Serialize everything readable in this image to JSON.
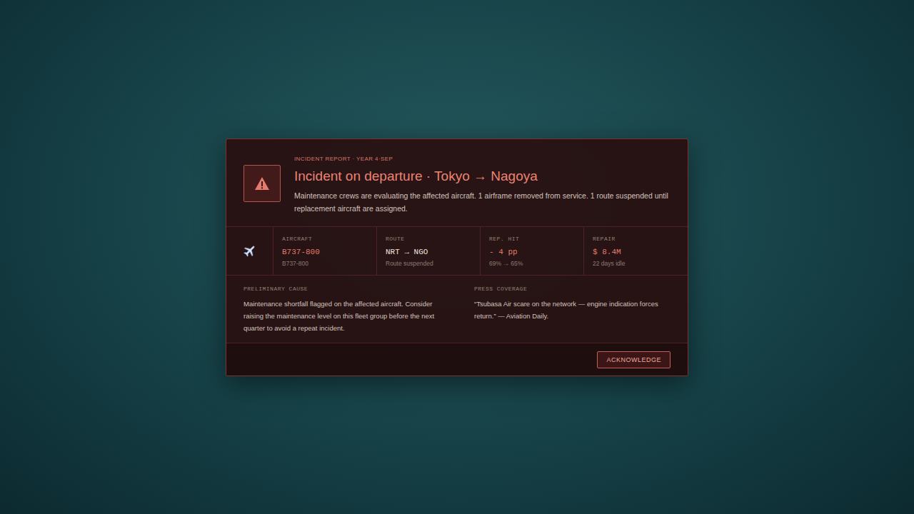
{
  "incident": {
    "overline": "INCIDENT REPORT · YEAR 4·SEP",
    "title": "Incident on departure · Tokyo → Nagoya",
    "description": "Maintenance crews are evaluating the affected aircraft. 1 airframe removed from service. 1 route suspended until replacement aircraft are assigned."
  },
  "stats": [
    {
      "label": "AIRCRAFT",
      "value": "B737-800",
      "detail": "B737-800",
      "color": "#e07b6e"
    },
    {
      "label": "ROUTE",
      "value": "NRT → NGO",
      "detail": "Route suspended",
      "color": "#eee2de"
    },
    {
      "label": "REP. HIT",
      "value": "- 4 pp",
      "detail": "69% → 65%",
      "color": "#e07b6e"
    },
    {
      "label": "REPAIR",
      "value": "$ 8.4M",
      "detail": "22 days idle",
      "color": "#e07b6e"
    }
  ],
  "notes": [
    {
      "label": "PRELIMINARY CAUSE",
      "text": "Maintenance shortfall flagged on the affected aircraft. Consider raising the maintenance level on this fleet group before the next quarter to avoid a repeat incident."
    },
    {
      "label": "PRESS COVERAGE",
      "text": "“Tsubasa Air scare on the network — engine indication forces return.” — Aviation Daily."
    }
  ],
  "buttons": [
    "ACKNOWLEDGE"
  ]
}
